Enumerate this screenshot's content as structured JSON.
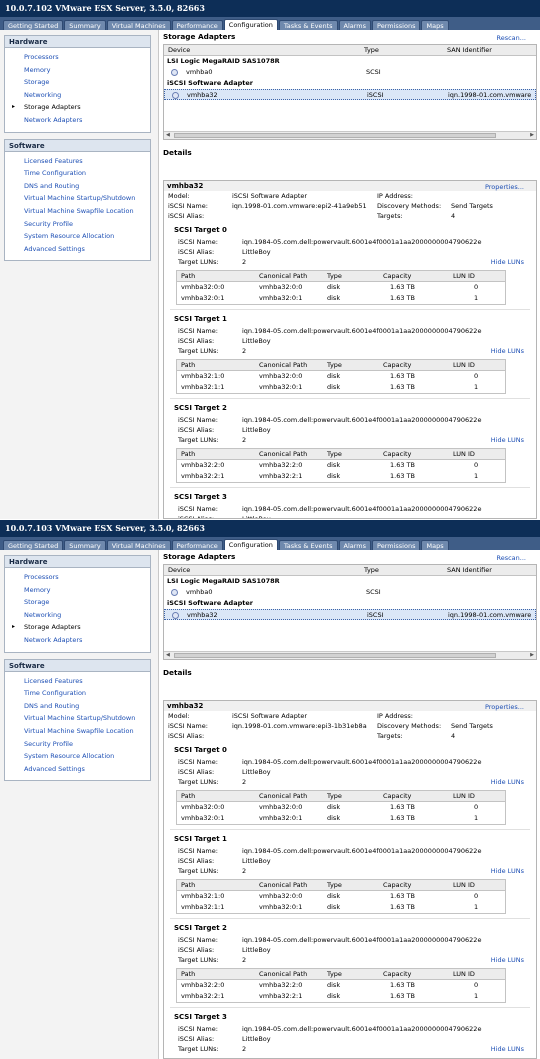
{
  "tabs": [
    "Getting Started",
    "Summary",
    "Virtual Machines",
    "Performance",
    "Configuration",
    "Tasks & Events",
    "Alarms",
    "Permissions",
    "Maps"
  ],
  "left": {
    "hardware_title": "Hardware",
    "hardware_items": [
      "Processors",
      "Memory",
      "Storage",
      "Networking",
      "Storage Adapters",
      "Network Adapters"
    ],
    "software_title": "Software",
    "software_items": [
      "Licensed Features",
      "Time Configuration",
      "DNS and Routing",
      "Virtual Machine Startup/Shutdown",
      "Virtual Machine Swapfile Location",
      "Security Profile",
      "System Resource Allocation",
      "Advanced Settings"
    ]
  },
  "storage": {
    "title": "Storage Adapters",
    "rescan": "Rescan...",
    "col_device": "Device",
    "col_type": "Type",
    "col_san": "SAN Identifier",
    "group1": "LSI Logic MegaRAID SAS1078R",
    "hba0": "vmhba0",
    "hba0_type": "SCSI",
    "group2": "iSCSI Software Adapter",
    "hba32": "vmhba32",
    "hba32_type": "iSCSI",
    "hba32_san": "iqn.1998-01.com.vmware"
  },
  "details": {
    "title": "Details",
    "adapter": "vmhba32",
    "properties": "Properties...",
    "model_label": "Model:",
    "model": "iSCSI Software Adapter",
    "name_label": "iSCSI Name:",
    "alias_label": "iSCSI Alias:",
    "ip_label": "IP Address:",
    "disc_label": "Discovery Methods:",
    "disc": "Send Targets",
    "targets_label": "Targets:",
    "targets": "4"
  },
  "target": {
    "name_label": "iSCSI Name:",
    "alias_label": "iSCSI Alias:",
    "luns_label": "Target LUNs:",
    "hide": "Hide LUNs",
    "iqn": "iqn.1984-05.com.dell:powervault.6001e4f0001a1aa2000000004790622e",
    "alias": "LittleBoy",
    "luns": "2",
    "col_path": "Path",
    "col_canon": "Canonical Path",
    "col_type": "Type",
    "col_cap": "Capacity",
    "col_lun": "LUN ID",
    "type": "disk",
    "cap": "1.63 TB"
  },
  "panels": [
    {
      "title": "10.0.7.102 VMware ESX Server, 3.5.0, 82663",
      "iscsi_name": "iqn.1998-01.com.vmware:epi2-41a9eb51",
      "targets": [
        {
          "name": "SCSI Target 0",
          "rows": [
            [
              "vmhba32:0:0",
              "vmhba32:0:0",
              "0"
            ],
            [
              "vmhba32:0:1",
              "vmhba32:0:1",
              "1"
            ]
          ]
        },
        {
          "name": "SCSI Target 1",
          "rows": [
            [
              "vmhba32:1:0",
              "vmhba32:0:0",
              "0"
            ],
            [
              "vmhba32:1:1",
              "vmhba32:0:1",
              "1"
            ]
          ]
        },
        {
          "name": "SCSI Target 2",
          "rows": [
            [
              "vmhba32:2:0",
              "vmhba32:2:0",
              "0"
            ],
            [
              "vmhba32:2:1",
              "vmhba32:2:1",
              "1"
            ]
          ]
        },
        {
          "name": "SCSI Target 3",
          "rows": []
        }
      ]
    },
    {
      "title": "10.0.7.103 VMware ESX Server, 3.5.0, 82663",
      "iscsi_name": "iqn.1998-01.com.vmware:epi3-1b31eb8a",
      "targets": [
        {
          "name": "SCSI Target 0",
          "rows": [
            [
              "vmhba32:0:0",
              "vmhba32:0:0",
              "0"
            ],
            [
              "vmhba32:0:1",
              "vmhba32:0:1",
              "1"
            ]
          ]
        },
        {
          "name": "SCSI Target 1",
          "rows": [
            [
              "vmhba32:1:0",
              "vmhba32:0:0",
              "0"
            ],
            [
              "vmhba32:1:1",
              "vmhba32:0:1",
              "1"
            ]
          ]
        },
        {
          "name": "SCSI Target 2",
          "rows": [
            [
              "vmhba32:2:0",
              "vmhba32:2:0",
              "0"
            ],
            [
              "vmhba32:2:1",
              "vmhba32:2:1",
              "1"
            ]
          ]
        },
        {
          "name": "SCSI Target 3",
          "rows": []
        }
      ]
    }
  ]
}
